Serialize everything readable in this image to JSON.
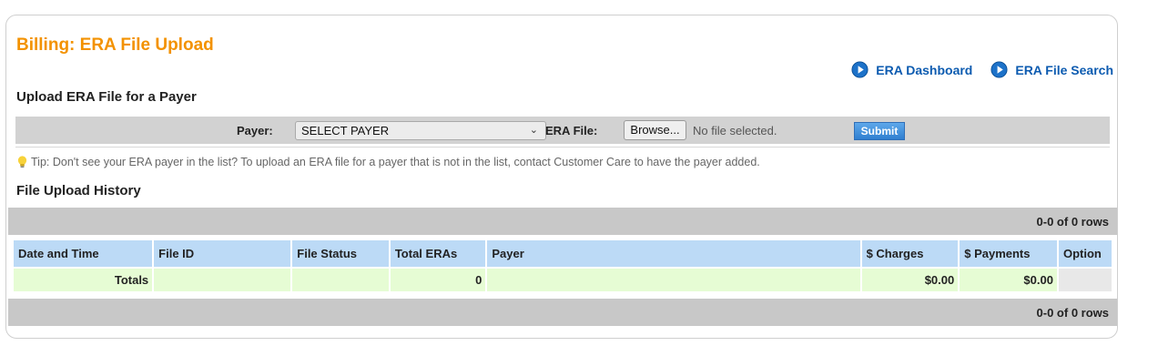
{
  "page": {
    "title": "Billing: ERA File Upload"
  },
  "links": {
    "era_dashboard": "ERA Dashboard",
    "era_file_search": "ERA File Search"
  },
  "upload": {
    "section_title": "Upload ERA File for a Payer",
    "payer_label": "Payer:",
    "payer_selected": "SELECT PAYER",
    "era_file_label": "ERA File:",
    "browse_label": "Browse...",
    "no_file_text": "No file selected.",
    "submit_label": "Submit"
  },
  "tip": {
    "text": "Tip: Don't see your ERA payer in the list? To upload an ERA file for a payer that is not in the list, contact Customer Care to have the payer added."
  },
  "history": {
    "section_title": "File Upload History",
    "pager_text": "0-0 of 0 rows",
    "columns": [
      "Date and Time",
      "File ID",
      "File Status",
      "Total ERAs",
      "Payer",
      "$ Charges",
      "$ Payments",
      "Option"
    ],
    "totals": {
      "label": "Totals",
      "file_id": "",
      "file_status": "",
      "total_eras": "0",
      "payer": "",
      "charges": "$0.00",
      "payments": "$0.00",
      "option": ""
    }
  },
  "colors": {
    "title_orange": "#f39200",
    "link_blue": "#0c5bb0",
    "header_blue": "#bcdaf6",
    "totals_green": "#e6fcd4",
    "bar_gray": "#c8c8c8"
  },
  "icons": {
    "link_icon": "play-circle-icon",
    "tip_icon": "lightbulb-icon"
  }
}
